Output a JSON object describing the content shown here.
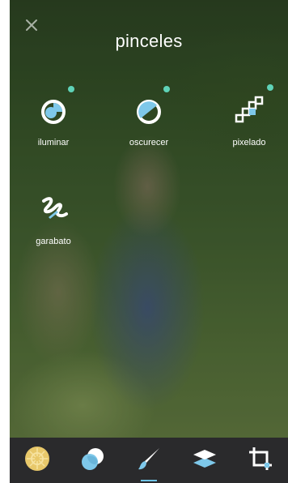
{
  "header": {
    "title": "pinceles"
  },
  "tools": [
    {
      "label": "iluminar",
      "icon": "lighten-brush-icon",
      "has_dot": true
    },
    {
      "label": "oscurecer",
      "icon": "darken-brush-icon",
      "has_dot": true
    },
    {
      "label": "pixelado",
      "icon": "pixelate-brush-icon",
      "has_dot": true
    },
    {
      "label": "garabato",
      "icon": "doodle-brush-icon",
      "has_dot": false
    }
  ],
  "tabbar": {
    "items": [
      {
        "icon": "adjust-wheel-icon",
        "active": false
      },
      {
        "icon": "overlay-circles-icon",
        "active": false
      },
      {
        "icon": "brush-icon",
        "active": true
      },
      {
        "icon": "layers-icon",
        "active": false
      },
      {
        "icon": "crop-icon",
        "active": false
      }
    ]
  },
  "colors": {
    "accent_dot": "#5fd3b8",
    "icon_blue": "#7ec8ea",
    "tabbar_bg": "#2a2a2c",
    "adjust_icon": "#e8c86a"
  }
}
